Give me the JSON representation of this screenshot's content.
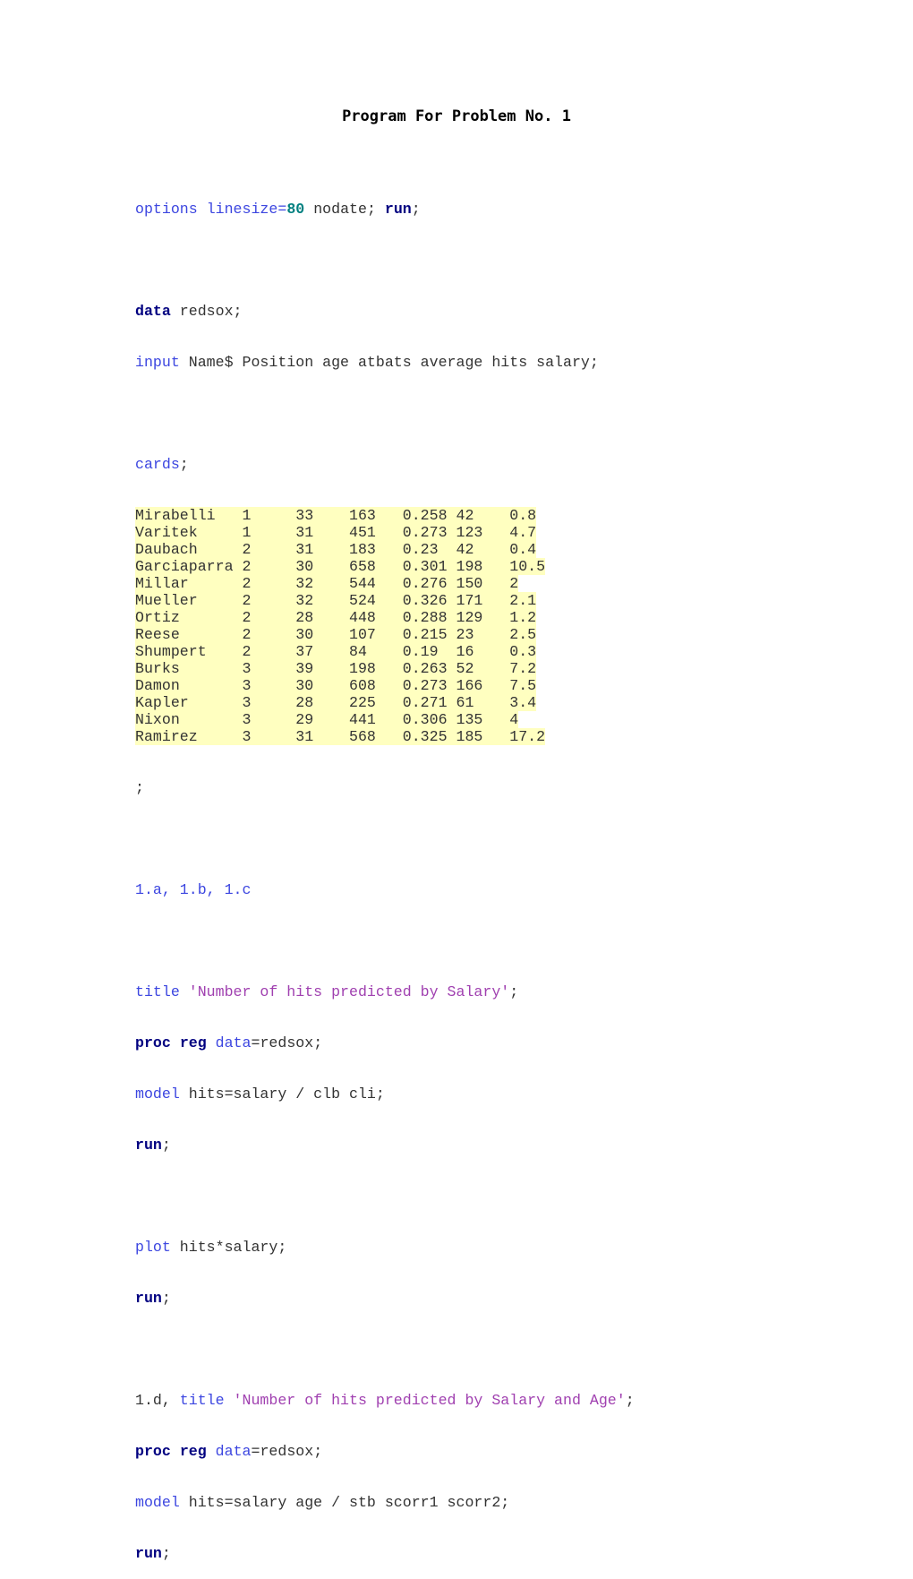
{
  "document": {
    "title": "Program For Problem No. 1"
  },
  "code": {
    "options_line": {
      "kw1": "options",
      "kw2": "linesize",
      "eq": "=",
      "num": "80",
      "rest": " nodate; ",
      "run": "run",
      "semi": ";"
    },
    "data_line": {
      "kw": "data",
      "rest": " redsox;"
    },
    "input_line": {
      "kw": "input",
      "rest": " Name$ Position age atbats average hits salary;"
    },
    "cards_line": {
      "kw": "cards",
      "rest": ";"
    },
    "data_rows": [
      "Mirabelli   1     33    163   0.258 42    0.8",
      "Varitek     1     31    451   0.273 123   4.7",
      "Daubach     2     31    183   0.23  42    0.4",
      "Garciaparra 2     30    658   0.301 198   10.5",
      "Millar      2     32    544   0.276 150   2",
      "Mueller     2     32    524   0.326 171   2.1",
      "Ortiz       2     28    448   0.288 129   1.2",
      "Reese       2     30    107   0.215 23    2.5",
      "Shumpert    2     37    84    0.19  16    0.3",
      "Burks       3     39    198   0.263 52    7.2",
      "Damon       3     30    608   0.273 166   7.5",
      "Kapler      3     28    225   0.271 61    3.4",
      "Nixon       3     29    441   0.306 135   4",
      "Ramirez     3     31    568   0.325 185   17.2"
    ],
    "end_cards": ";",
    "section_1abc": "1.a, 1.b, 1.c",
    "title1_line": {
      "kw": "title",
      "str": " 'Number of hits predicted by Salary'",
      "semi": ";"
    },
    "proc1_line": {
      "kw1": "proc",
      "kw2": "reg",
      "opt": "data",
      "rest": "=redsox;"
    },
    "model1_line": {
      "kw": "model",
      "rest": " hits=salary / clb cli;"
    },
    "run1": {
      "kw": "run",
      "semi": ";"
    },
    "plot_line": {
      "kw": "plot",
      "rest": " hits*salary;"
    },
    "run2": {
      "kw": "run",
      "semi": ";"
    },
    "title2_line": {
      "prefix": "1.d, ",
      "kw": "title",
      "str": " 'Number of hits predicted by Salary and Age'",
      "semi": ";"
    },
    "proc2_line": {
      "kw1": "proc",
      "kw2": "reg",
      "opt": "data",
      "rest": "=redsox;"
    },
    "model2_line": {
      "kw": "model",
      "rest": " hits=salary age / stb scorr1 scorr2;"
    },
    "run3": {
      "kw": "run",
      "semi": ";"
    }
  }
}
